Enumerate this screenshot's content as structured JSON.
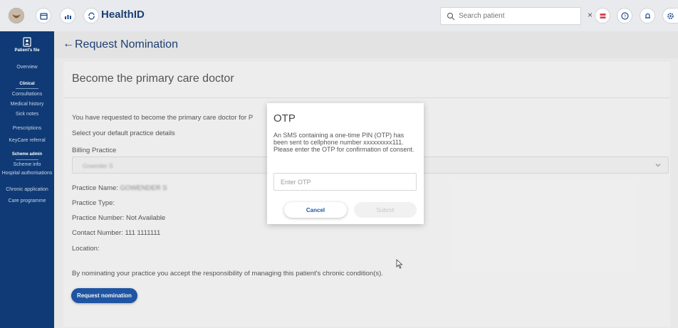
{
  "topbar": {
    "app_title": "HealthID",
    "search": {
      "placeholder": "Search patient",
      "value": ""
    },
    "clear_glyph": "×",
    "icons": [
      "logo-icon",
      "calendar-icon",
      "chart-icon",
      "sync-icon",
      "flag-icon",
      "help-icon",
      "bell-icon",
      "settings-icon"
    ]
  },
  "sidebar": {
    "patients_file": "Patient's file",
    "overview": "Overview",
    "clinical_header": "Clinical",
    "clinical_items": [
      "Consultations",
      "Medical history",
      "Sick notes",
      "Prescriptions",
      "KeyCare referral"
    ],
    "scheme_header": "Scheme admin",
    "scheme_items": [
      "Scheme info",
      "Hospital authorisations",
      "Chronic application",
      "Care programme"
    ]
  },
  "page": {
    "back_glyph": "←",
    "title": "Request Nomination"
  },
  "card": {
    "title": "Become the primary care doctor",
    "request_text": "You have requested to become the primary care doctor for P",
    "select_prompt": "Select your default practice details",
    "billing_label": "Billing Practice",
    "billing_value": "Gowrider S",
    "practice_name_label": "Practice Name:",
    "practice_name_value": "GOWENDER S",
    "practice_type": "Practice Type:",
    "practice_number": "Practice Number: Not Available",
    "contact_number": "Contact Number: 111 1111111",
    "location": "Location:",
    "disclaimer": "By nominating your practice you accept the responsibility of managing this patient's chronic condition(s).",
    "nominate_button": "Request nomination"
  },
  "modal": {
    "title": "OTP",
    "body": "An SMS containing a one-time PIN (OTP) has been sent to cellphone number xxxxxxxxx111. Please enter the OTP for confirmation of consent.",
    "input_placeholder": "Enter OTP",
    "input_value": "",
    "cancel_label": "Cancel",
    "submit_label": "Submit"
  },
  "colors": {
    "brand": "#1b3f74",
    "sidebar": "#0f3a75",
    "primary_button": "#1c56a8",
    "flag_accent": "#d9434f"
  }
}
